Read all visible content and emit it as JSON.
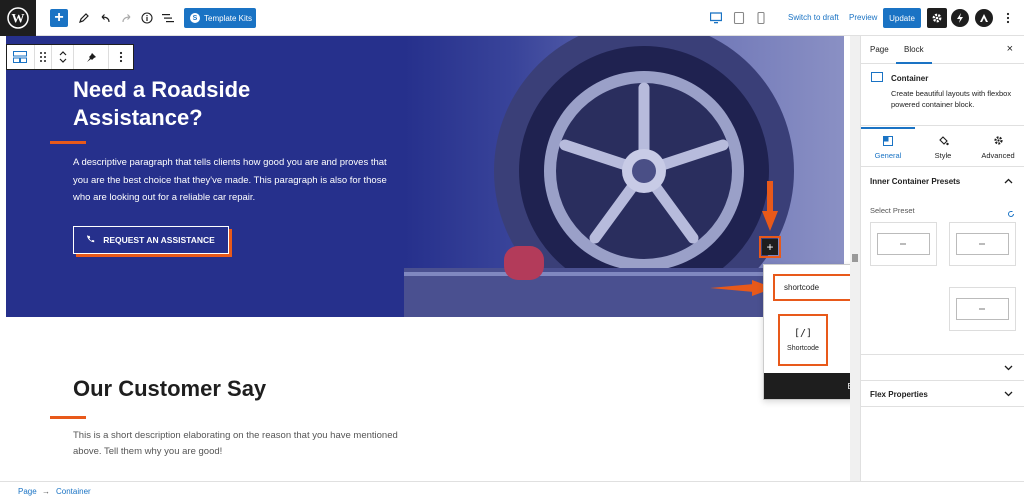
{
  "toolbar": {
    "add_symbol": "+",
    "template_kits_icon": "S",
    "template_kits": "Template Kits",
    "switch_to_draft": "Switch to draft",
    "preview": "Preview",
    "update": "Update",
    "accent_color": "#1a73c4"
  },
  "hero": {
    "title": "Need a Roadside Assistance?",
    "paragraph": "A descriptive paragraph that tells clients how good you are and proves that you are the best choice that they've made. This paragraph is also for those who are looking out for a reliable car repair.",
    "cta_label": "REQUEST AN ASSISTANCE",
    "background_color": "#26308c",
    "accent_color": "#e8591a"
  },
  "section": {
    "title": "Our Customer Say",
    "description": "This is a short description elaborating on the reason that you have mentioned above. Tell them why you are good!"
  },
  "inserter": {
    "plus_symbol": "+",
    "search_value": "shortcode",
    "close_symbol": "×",
    "result_icon": "[/]",
    "result_label": "Shortcode",
    "browse_all": "Browse all"
  },
  "sidebar": {
    "tab_page": "Page",
    "tab_block": "Block",
    "close_symbol": "×",
    "block_title": "Container",
    "block_desc": "Create beautiful layouts with flexbox powered container block.",
    "subtab_general": "General",
    "subtab_style": "Style",
    "subtab_advanced": "Advanced",
    "inner_presets_title": "Inner Container Presets",
    "select_preset": "Select Preset",
    "flex_properties": "Flex Properties"
  },
  "breadcrumb": {
    "page": "Page",
    "separator": "→",
    "container": "Container"
  }
}
